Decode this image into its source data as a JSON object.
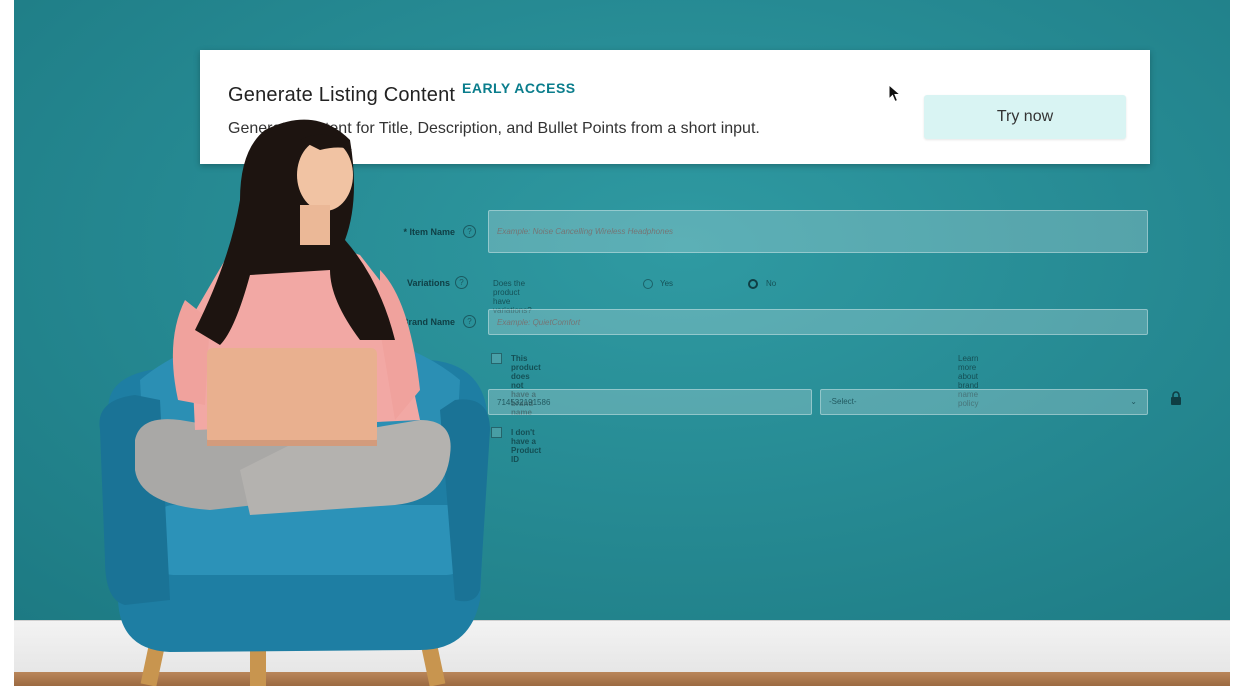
{
  "banner": {
    "title": "Generate Listing Content",
    "badge": "EARLY ACCESS",
    "description": "Generate content for Title, Description, and Bullet Points from a short input.",
    "button_label": "Try now"
  },
  "form": {
    "item_name": {
      "label": "* Item Name",
      "placeholder": "Example: Noise Cancelling Wireless Headphones"
    },
    "variations": {
      "label": "Variations",
      "question": "Does the product have variations?",
      "options": [
        "Yes",
        "No"
      ],
      "selected": "No"
    },
    "brand_name": {
      "label": "Brand Name",
      "placeholder": "Example: QuietComfort",
      "checkbox_label": "This product does not have a brand name",
      "policy_link": "Learn more about brand name policy"
    },
    "product_id": {
      "value": "714532191586",
      "select_value": "-Select-",
      "checkbox_label": "I don't have a Product ID"
    }
  },
  "colors": {
    "wall": "#258891",
    "button_bg": "#d9f4f3",
    "badge": "#0a7d8c"
  },
  "icons": [
    "help-icon",
    "cursor-icon",
    "lock-icon",
    "chevron-down-icon"
  ]
}
